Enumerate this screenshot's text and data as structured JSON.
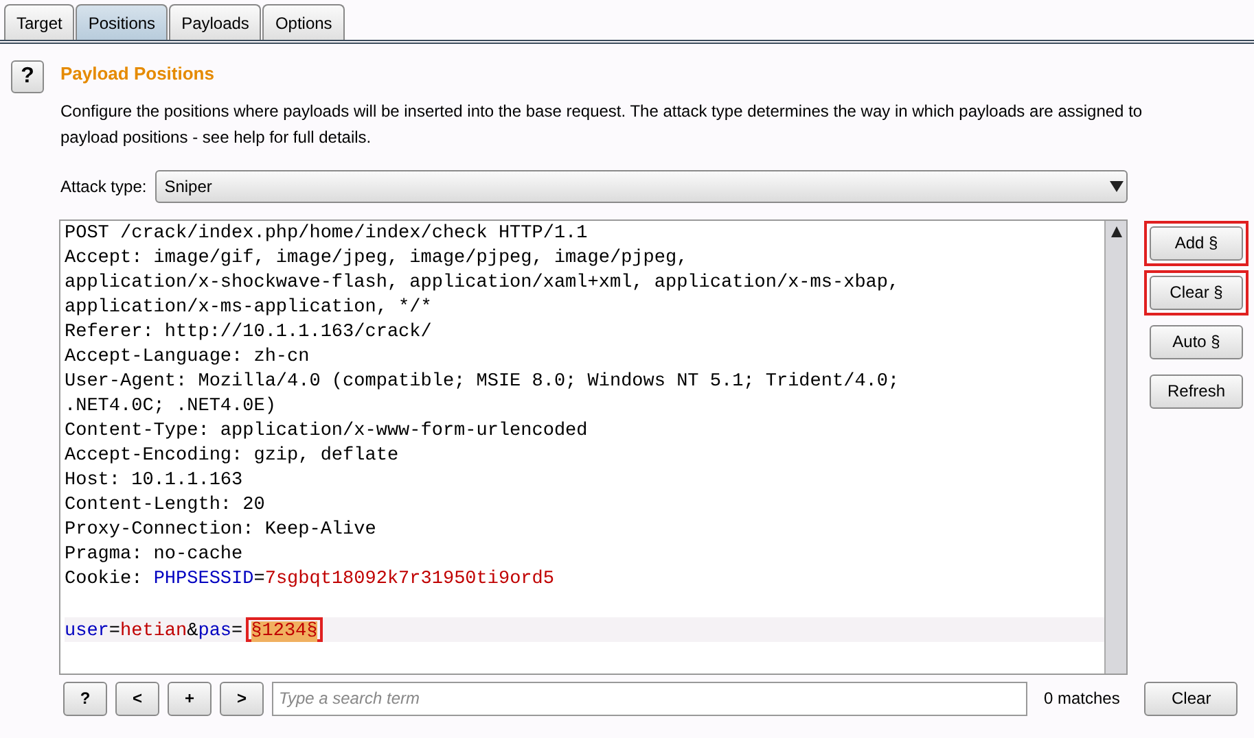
{
  "tabs": [
    {
      "label": "Target",
      "selected": false
    },
    {
      "label": "Positions",
      "selected": true
    },
    {
      "label": "Payloads",
      "selected": false
    },
    {
      "label": "Options",
      "selected": false
    }
  ],
  "help_icon": "?",
  "section": {
    "title": "Payload Positions",
    "description": "Configure the positions where payloads will be inserted into the base request. The attack type determines the way in which payloads are assigned to payload positions - see help for full details."
  },
  "attack_type": {
    "label": "Attack type:",
    "value": "Sniper"
  },
  "request_lines": [
    {
      "current": false,
      "segments": [
        {
          "kind": "text",
          "text": "POST /crack/index.php/home/index/check HTTP/1.1"
        }
      ]
    },
    {
      "current": false,
      "segments": [
        {
          "kind": "text",
          "text": "Accept: image/gif, image/jpeg, image/pjpeg, image/pjpeg,"
        }
      ]
    },
    {
      "current": false,
      "segments": [
        {
          "kind": "text",
          "text": "application/x-shockwave-flash, application/xaml+xml, application/x-ms-xbap,"
        }
      ]
    },
    {
      "current": false,
      "segments": [
        {
          "kind": "text",
          "text": "application/x-ms-application, */*"
        }
      ]
    },
    {
      "current": false,
      "segments": [
        {
          "kind": "text",
          "text": "Referer: http://10.1.1.163/crack/"
        }
      ]
    },
    {
      "current": false,
      "segments": [
        {
          "kind": "text",
          "text": "Accept-Language: zh-cn"
        }
      ]
    },
    {
      "current": false,
      "segments": [
        {
          "kind": "text",
          "text": "User-Agent: Mozilla/4.0 (compatible; MSIE 8.0; Windows NT 5.1; Trident/4.0;"
        }
      ]
    },
    {
      "current": false,
      "segments": [
        {
          "kind": "text",
          "text": ".NET4.0C; .NET4.0E)"
        }
      ]
    },
    {
      "current": false,
      "segments": [
        {
          "kind": "text",
          "text": "Content-Type: application/x-www-form-urlencoded"
        }
      ]
    },
    {
      "current": false,
      "segments": [
        {
          "kind": "text",
          "text": "Accept-Encoding: gzip, deflate"
        }
      ]
    },
    {
      "current": false,
      "segments": [
        {
          "kind": "text",
          "text": "Host: 10.1.1.163"
        }
      ]
    },
    {
      "current": false,
      "segments": [
        {
          "kind": "text",
          "text": "Content-Length: 20"
        }
      ]
    },
    {
      "current": false,
      "segments": [
        {
          "kind": "text",
          "text": "Proxy-Connection: Keep-Alive"
        }
      ]
    },
    {
      "current": false,
      "segments": [
        {
          "kind": "text",
          "text": "Pragma: no-cache"
        }
      ]
    },
    {
      "current": false,
      "segments": [
        {
          "kind": "text",
          "text": "Cookie: "
        },
        {
          "kind": "name",
          "text": "PHPSESSID"
        },
        {
          "kind": "text",
          "text": "="
        },
        {
          "kind": "value",
          "text": "7sgbqt18092k7r31950ti9ord5"
        }
      ]
    },
    {
      "current": false
    },
    {
      "current": true,
      "segments": [
        {
          "kind": "name",
          "text": "user"
        },
        {
          "kind": "text",
          "text": "="
        },
        {
          "kind": "value",
          "text": "hetian"
        },
        {
          "kind": "text",
          "text": "&"
        },
        {
          "kind": "name",
          "text": "pas"
        },
        {
          "kind": "text",
          "text": "="
        },
        {
          "kind": "marker",
          "text": "§1234§",
          "outlined": true
        }
      ]
    }
  ],
  "side_buttons": [
    {
      "label": "Add §",
      "outlined": true
    },
    {
      "label": "Clear §",
      "outlined": true
    },
    {
      "label": "Auto §",
      "outlined": false
    },
    {
      "label": "Refresh",
      "outlined": false
    }
  ],
  "search": {
    "buttons": [
      "?",
      "<",
      "+",
      ">"
    ],
    "placeholder": "Type a search term",
    "matches": "0 matches",
    "clear": "Clear"
  }
}
